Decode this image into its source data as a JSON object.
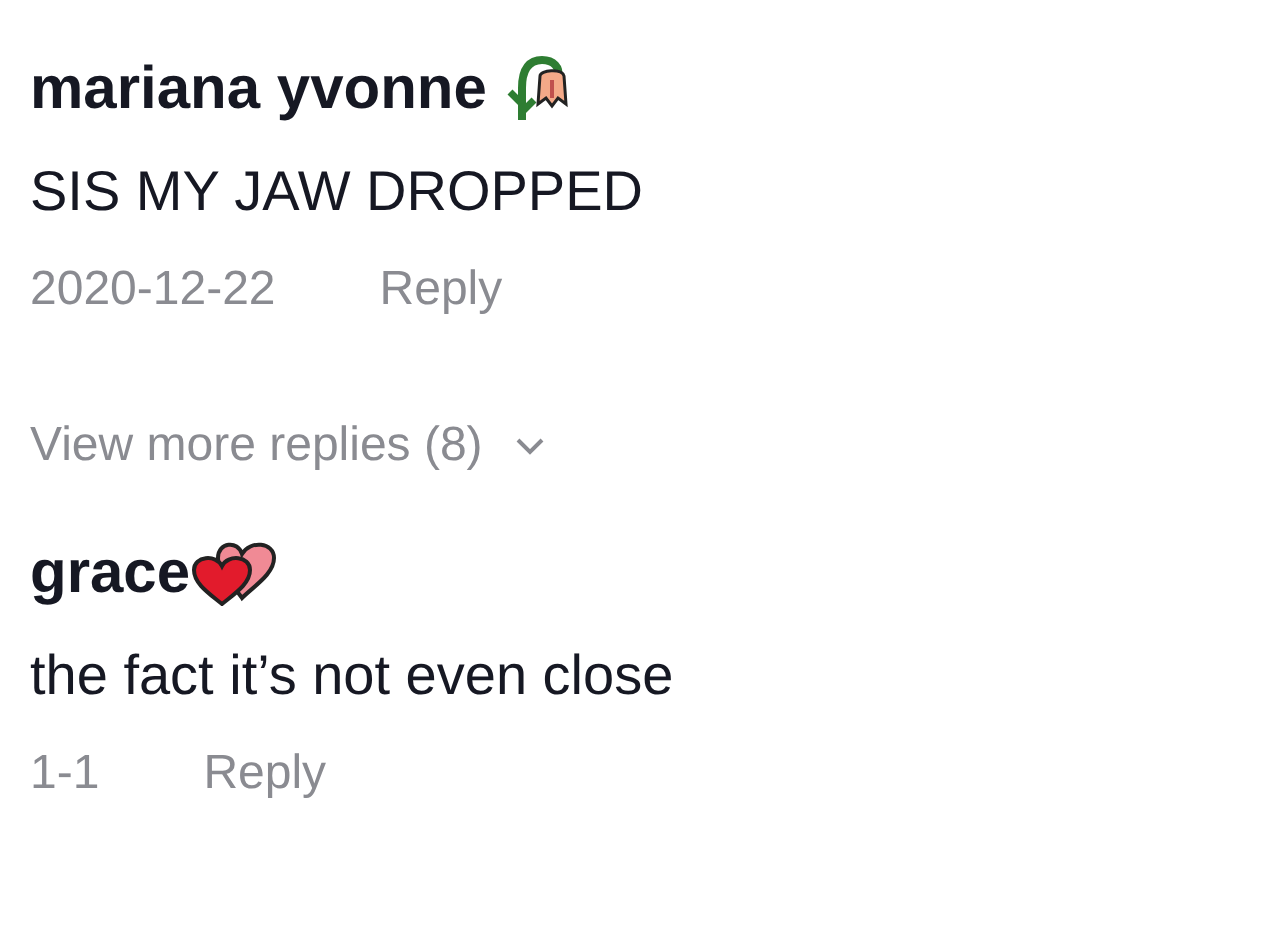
{
  "comments": [
    {
      "author": "mariana yvonne",
      "text": "SIS MY JAW DROPPED",
      "date": "2020-12-22",
      "reply": "Reply",
      "more_replies": "View more replies (8)"
    },
    {
      "author": "grace",
      "text": "the fact it’s not even close",
      "date": "1-1",
      "reply": "Reply"
    }
  ]
}
